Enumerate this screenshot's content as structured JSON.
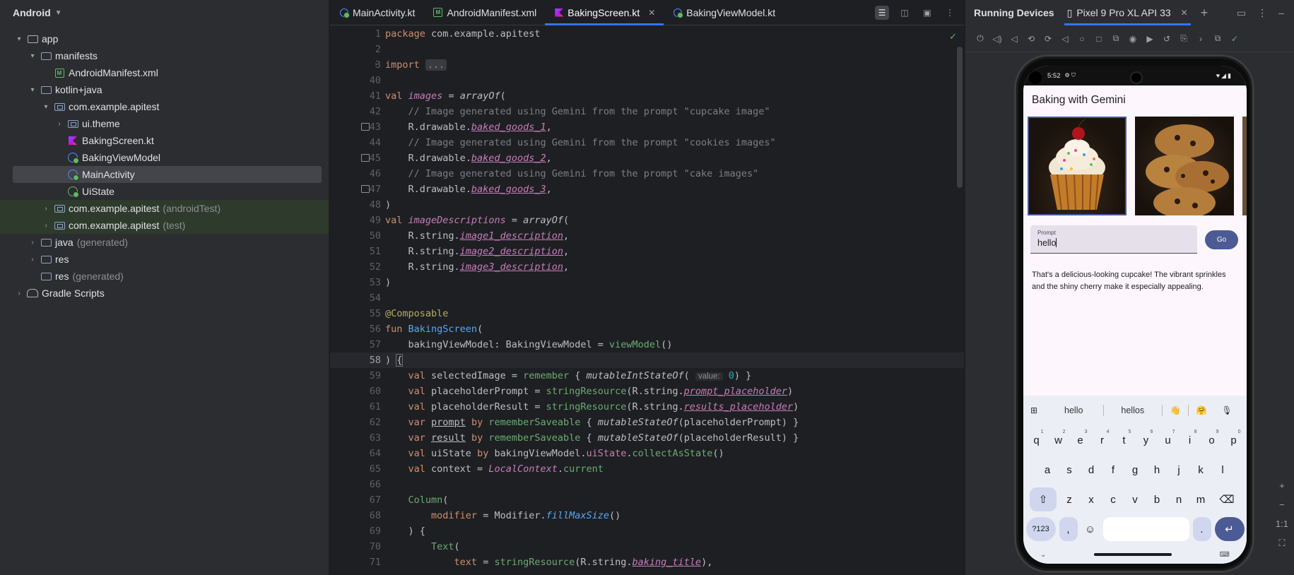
{
  "project": {
    "view_label": "Android",
    "tree": [
      {
        "label": "app",
        "suffix": "",
        "depth": 0,
        "arrow": "v",
        "icon": "module-folder-icon"
      },
      {
        "label": "manifests",
        "suffix": "",
        "depth": 1,
        "arrow": "v",
        "icon": "folder-icon"
      },
      {
        "label": "AndroidManifest.xml",
        "suffix": "",
        "depth": 2,
        "arrow": "",
        "icon": "xml-file-icon"
      },
      {
        "label": "kotlin+java",
        "suffix": "",
        "depth": 1,
        "arrow": "v",
        "icon": "folder-icon"
      },
      {
        "label": "com.example.apitest",
        "suffix": "",
        "depth": 2,
        "arrow": "v",
        "icon": "package-icon"
      },
      {
        "label": "ui.theme",
        "suffix": "",
        "depth": 3,
        "arrow": ">",
        "icon": "package-icon"
      },
      {
        "label": "BakingScreen.kt",
        "suffix": "",
        "depth": 3,
        "arrow": "",
        "icon": "kotlin-file-icon"
      },
      {
        "label": "BakingViewModel",
        "suffix": "",
        "depth": 3,
        "arrow": "",
        "icon": "class-icon"
      },
      {
        "label": "MainActivity",
        "suffix": "",
        "depth": 3,
        "arrow": "",
        "icon": "class-icon",
        "selected": true
      },
      {
        "label": "UiState",
        "suffix": "",
        "depth": 3,
        "arrow": "",
        "icon": "interface-icon"
      },
      {
        "label": "com.example.apitest",
        "suffix": "(androidTest)",
        "depth": 2,
        "arrow": ">",
        "icon": "package-icon",
        "test": true
      },
      {
        "label": "com.example.apitest",
        "suffix": "(test)",
        "depth": 2,
        "arrow": ">",
        "icon": "package-icon",
        "test": true
      },
      {
        "label": "java",
        "suffix": "(generated)",
        "depth": 1,
        "arrow": ">",
        "icon": "folder-icon"
      },
      {
        "label": "res",
        "suffix": "",
        "depth": 1,
        "arrow": ">",
        "icon": "folder-icon"
      },
      {
        "label": "res",
        "suffix": "(generated)",
        "depth": 1,
        "arrow": "",
        "icon": "folder-icon"
      },
      {
        "label": "Gradle Scripts",
        "suffix": "",
        "depth": 0,
        "arrow": ">",
        "icon": "gradle-icon"
      }
    ]
  },
  "editor": {
    "tabs": [
      {
        "label": "MainActivity.kt",
        "icon": "class-icon",
        "active": false
      },
      {
        "label": "AndroidManifest.xml",
        "icon": "xml-file-icon",
        "active": false
      },
      {
        "label": "BakingScreen.kt",
        "icon": "kotlin-file-icon",
        "active": true
      },
      {
        "label": "BakingViewModel.kt",
        "icon": "class-icon",
        "active": false
      }
    ],
    "current_line": "58",
    "lines": [
      {
        "n": "1",
        "html": "<span class=\"kw\">package</span> com.example.apitest"
      },
      {
        "n": "2",
        "html": ""
      },
      {
        "n": "3",
        "html": "<span class=\"kw\">import</span> <span class=\"fold-box\">...</span>",
        "fold": true
      },
      {
        "n": "40",
        "html": ""
      },
      {
        "n": "41",
        "html": "<span class=\"kw\">val</span> <span class=\"prop it\">images</span> = <span class=\"it\">arrayOf</span>("
      },
      {
        "n": "42",
        "html": "    <span class=\"cmt\">// Image generated using Gemini from the prompt \"cupcake image\"</span>"
      },
      {
        "n": "43",
        "html": "    R.drawable.<span class=\"fld\">baked_goods_1</span>,",
        "img": true
      },
      {
        "n": "44",
        "html": "    <span class=\"cmt\">// Image generated using Gemini from the prompt \"cookies images\"</span>"
      },
      {
        "n": "45",
        "html": "    R.drawable.<span class=\"fld\">baked_goods_2</span>,",
        "img": true
      },
      {
        "n": "46",
        "html": "    <span class=\"cmt\">// Image generated using Gemini from the prompt \"cake images\"</span>"
      },
      {
        "n": "47",
        "html": "    R.drawable.<span class=\"fld\">baked_goods_3</span>,",
        "img": true
      },
      {
        "n": "48",
        "html": ")"
      },
      {
        "n": "49",
        "html": "<span class=\"kw\">val</span> <span class=\"prop it\">imageDescriptions</span> = <span class=\"it\">arrayOf</span>("
      },
      {
        "n": "50",
        "html": "    R.string.<span class=\"fld\">image1_description</span>,"
      },
      {
        "n": "51",
        "html": "    R.string.<span class=\"fld\">image2_description</span>,"
      },
      {
        "n": "52",
        "html": "    R.string.<span class=\"fld\">image3_description</span>,"
      },
      {
        "n": "53",
        "html": ")"
      },
      {
        "n": "54",
        "html": ""
      },
      {
        "n": "55",
        "html": "<span class=\"ann\">@Composable</span>"
      },
      {
        "n": "56",
        "html": "<span class=\"kw\">fun</span> <span class=\"fn\">BakingScreen</span>("
      },
      {
        "n": "57",
        "html": "    bakingViewModel: BakingViewModel = <span class=\"str\">viewModel</span>()"
      },
      {
        "n": "58",
        "html": ") <span class=\"brace-hl\">{</span>",
        "current": true
      },
      {
        "n": "59",
        "html": "    <span class=\"kw\">val</span> selectedImage = <span class=\"str\">remember</span> { <span class=\"it\">mutableIntStateOf</span>( <span class=\"hint\">value:</span> <span class=\"num\">0</span>) }"
      },
      {
        "n": "60",
        "html": "    <span class=\"kw\">val</span> placeholderPrompt = <span class=\"str\">stringResource</span>(R.string.<span class=\"fld\">prompt_placeholder</span>)"
      },
      {
        "n": "61",
        "html": "    <span class=\"kw\">val</span> placeholderResult = <span class=\"str\">stringResource</span>(R.string.<span class=\"fld\">results_placeholder</span>)"
      },
      {
        "n": "62",
        "html": "    <span class=\"kw\">var</span> <span class=\"ul\">prompt</span> <span class=\"kw\">by</span> <span class=\"str\">rememberSaveable</span> { <span class=\"it\">mutableStateOf</span>(placeholderPrompt) }"
      },
      {
        "n": "63",
        "html": "    <span class=\"kw\">var</span> <span class=\"ul\">result</span> <span class=\"kw\">by</span> <span class=\"str\">rememberSaveable</span> { <span class=\"it\">mutableStateOf</span>(placeholderResult) }"
      },
      {
        "n": "64",
        "html": "    <span class=\"kw\">val</span> uiState <span class=\"kw\">by</span> bakingViewModel.<span class=\"prop\">uiState</span>.<span class=\"str\">collectAsState</span>()"
      },
      {
        "n": "65",
        "html": "    <span class=\"kw\">val</span> context = <span class=\"prop it\">LocalContext</span>.<span class=\"str\">current</span>"
      },
      {
        "n": "66",
        "html": ""
      },
      {
        "n": "67",
        "html": "    <span class=\"str\">Column</span>("
      },
      {
        "n": "68",
        "html": "        <span class=\"kw\">modifier</span> = Modifier.<span class=\"fn it\">fillMaxSize</span>()"
      },
      {
        "n": "69",
        "html": "    ) {"
      },
      {
        "n": "70",
        "html": "        <span class=\"str\">Text</span>("
      },
      {
        "n": "71",
        "html": "            <span class=\"kw\">text</span> = <span class=\"str\">stringResource</span>(R.string.<span class=\"fld\">baking_title</span>),"
      }
    ]
  },
  "devices": {
    "panel_title": "Running Devices",
    "device_tab": "Pixel 9 Pro XL API 33",
    "zoom_label": "1:1",
    "phone": {
      "time": "5:52",
      "app_title": "Baking with Gemini",
      "images": [
        {
          "name": "cupcake-image",
          "selected": true
        },
        {
          "name": "cookies-image",
          "selected": false
        },
        {
          "name": "cake-image",
          "selected": false
        }
      ],
      "prompt_label": "Prompt",
      "prompt_value": "hello",
      "go_label": "Go",
      "result_text": "That's a delicious-looking cupcake!  The vibrant sprinkles and the shiny cherry make it especially appealing.",
      "suggestions": [
        "hello",
        "hellos"
      ],
      "emoji_suggestions": [
        "👋",
        "🤗"
      ],
      "keyboard": {
        "row1": [
          [
            "q",
            "1"
          ],
          [
            "w",
            "2"
          ],
          [
            "e",
            "3"
          ],
          [
            "r",
            "4"
          ],
          [
            "t",
            "5"
          ],
          [
            "y",
            "6"
          ],
          [
            "u",
            "7"
          ],
          [
            "i",
            "8"
          ],
          [
            "o",
            "9"
          ],
          [
            "p",
            "0"
          ]
        ],
        "row2": [
          "a",
          "s",
          "d",
          "f",
          "g",
          "h",
          "j",
          "k",
          "l"
        ],
        "row3": [
          "z",
          "x",
          "c",
          "v",
          "b",
          "n",
          "m"
        ],
        "sym_label": "?123",
        "comma": ",",
        "period": "."
      }
    }
  },
  "colors": {
    "accent": "#3574f0",
    "ide_bg": "#1e1f22",
    "panel_bg": "#2b2d30",
    "button_primary": "#4c5a95"
  }
}
